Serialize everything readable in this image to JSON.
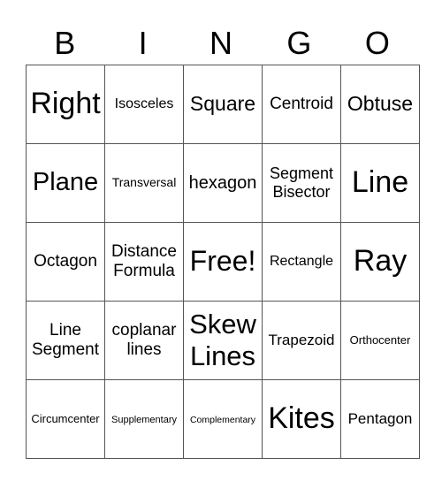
{
  "title_letters": [
    "B",
    "I",
    "N",
    "G",
    "O"
  ],
  "rows": [
    [
      {
        "text": "Right",
        "size": 34
      },
      {
        "text": "Isosceles",
        "size": 16
      },
      {
        "text": "Square",
        "size": 23
      },
      {
        "text": "Centroid",
        "size": 19
      },
      {
        "text": "Obtuse",
        "size": 23
      }
    ],
    [
      {
        "text": "Plane",
        "size": 29
      },
      {
        "text": "Transversal",
        "size": 14
      },
      {
        "text": "hexagon",
        "size": 20
      },
      {
        "text": "Segment Bisector",
        "size": 18
      },
      {
        "text": "Line",
        "size": 34
      }
    ],
    [
      {
        "text": "Octagon",
        "size": 19
      },
      {
        "text": "Distance Formula",
        "size": 19
      },
      {
        "text": "Free!",
        "size": 32
      },
      {
        "text": "Rectangle",
        "size": 16
      },
      {
        "text": "Ray",
        "size": 34
      }
    ],
    [
      {
        "text": "Line Segment",
        "size": 19
      },
      {
        "text": "coplanar lines",
        "size": 19
      },
      {
        "text": "Skew Lines",
        "size": 31
      },
      {
        "text": "Trapezoid",
        "size": 17
      },
      {
        "text": "Orthocenter",
        "size": 13
      }
    ],
    [
      {
        "text": "Circumcenter",
        "size": 13
      },
      {
        "text": "Supplementary",
        "size": 11
      },
      {
        "text": "Complementary",
        "size": 10.5
      },
      {
        "text": "Kites",
        "size": 34
      },
      {
        "text": "Pentagon",
        "size": 17
      }
    ]
  ]
}
